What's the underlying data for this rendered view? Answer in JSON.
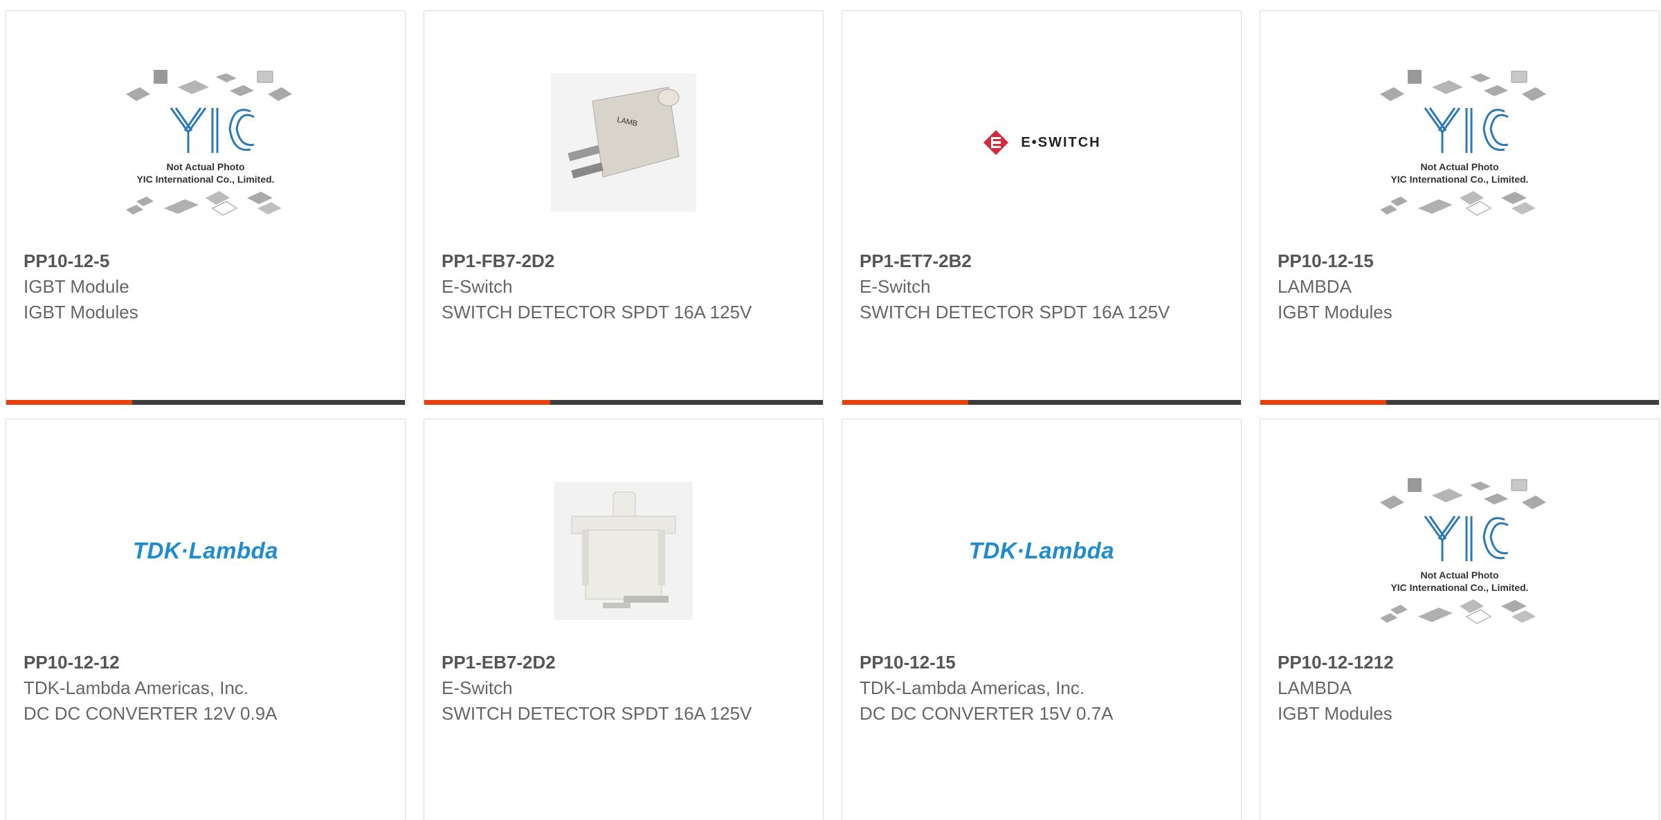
{
  "placeholder_caption": {
    "line1": "Not Actual Photo",
    "line2": "YIC International Co., Limited.",
    "logo": "YIC"
  },
  "brands": {
    "tdk": "TDK·Lambda",
    "eswitch": "E•SWITCH"
  },
  "products": [
    {
      "part": "PP10-12-5",
      "manufacturer": "IGBT Module",
      "description": "IGBT Modules",
      "image": "placeholder"
    },
    {
      "part": "PP1-FB7-2D2",
      "manufacturer": "E-Switch",
      "description": "SWITCH DETECTOR SPDT 16A 125V",
      "image": "switch-photo"
    },
    {
      "part": "PP1-ET7-2B2",
      "manufacturer": "E-Switch",
      "description": "SWITCH DETECTOR SPDT 16A 125V",
      "image": "eswitch-logo"
    },
    {
      "part": "PP10-12-15",
      "manufacturer": "LAMBDA",
      "description": "IGBT Modules",
      "image": "placeholder"
    },
    {
      "part": "PP10-12-12",
      "manufacturer": "TDK-Lambda Americas, Inc.",
      "description": "DC DC CONVERTER 12V 0.9A",
      "image": "tdk-logo"
    },
    {
      "part": "PP1-EB7-2D2",
      "manufacturer": "E-Switch",
      "description": "SWITCH DETECTOR SPDT 16A 125V",
      "image": "switch-photo-white"
    },
    {
      "part": "PP10-12-15",
      "manufacturer": "TDK-Lambda Americas, Inc.",
      "description": "DC DC CONVERTER 15V 0.7A",
      "image": "tdk-logo"
    },
    {
      "part": "PP10-12-1212",
      "manufacturer": "LAMBDA",
      "description": "IGBT Modules",
      "image": "placeholder"
    }
  ],
  "colors": {
    "accent": "#e8400c",
    "bar": "#3d3d3d",
    "tdk": "#1e8ccf",
    "eswitch": "#d42a3c"
  }
}
